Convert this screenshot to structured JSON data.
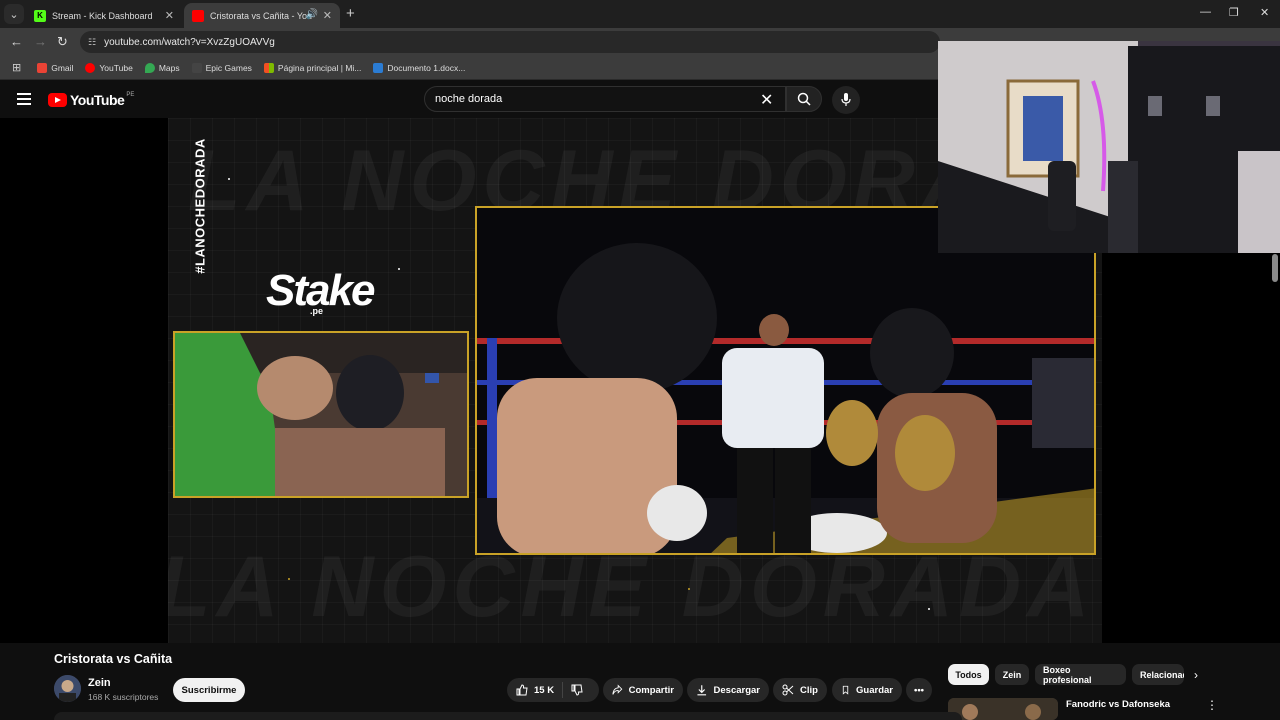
{
  "browser": {
    "tabs": [
      {
        "title": "Stream - Kick Dashboard",
        "active": false
      },
      {
        "title": "Cristorata vs Cañita - YouTube",
        "active": true
      }
    ],
    "url": "youtube.com/watch?v=XvzZgUOAVVg",
    "bookmarks": [
      "Gmail",
      "YouTube",
      "Maps",
      "Epic Games",
      "Página principal | Mi...",
      "Documento 1.docx..."
    ]
  },
  "youtube": {
    "logo_text": "YouTube",
    "region": "PE",
    "search_query": "noche dorada"
  },
  "player": {
    "hashtag": "#LANOCHEDORADA",
    "bg_text": "LA NOCHE DORADA",
    "sponsor": "Stake",
    "sponsor_suffix": ".pe"
  },
  "video": {
    "title": "Cristorata vs Cañita",
    "channel": "Zein",
    "subscribers": "168 K suscriptores",
    "subscribe_label": "Suscribirme",
    "likes": "15 K",
    "share_label": "Compartir",
    "download_label": "Descargar",
    "clip_label": "Clip",
    "save_label": "Guardar"
  },
  "sidebar": {
    "chips": [
      "Todos",
      "Zein",
      "Boxeo profesional",
      "Relacionado"
    ],
    "recommended": [
      {
        "title": "Fanodric vs Dafonseka"
      }
    ]
  },
  "colors": {
    "accent_gold": "#c9a227",
    "youtube_red": "#ff0000",
    "kick_green": "#53fc18"
  }
}
